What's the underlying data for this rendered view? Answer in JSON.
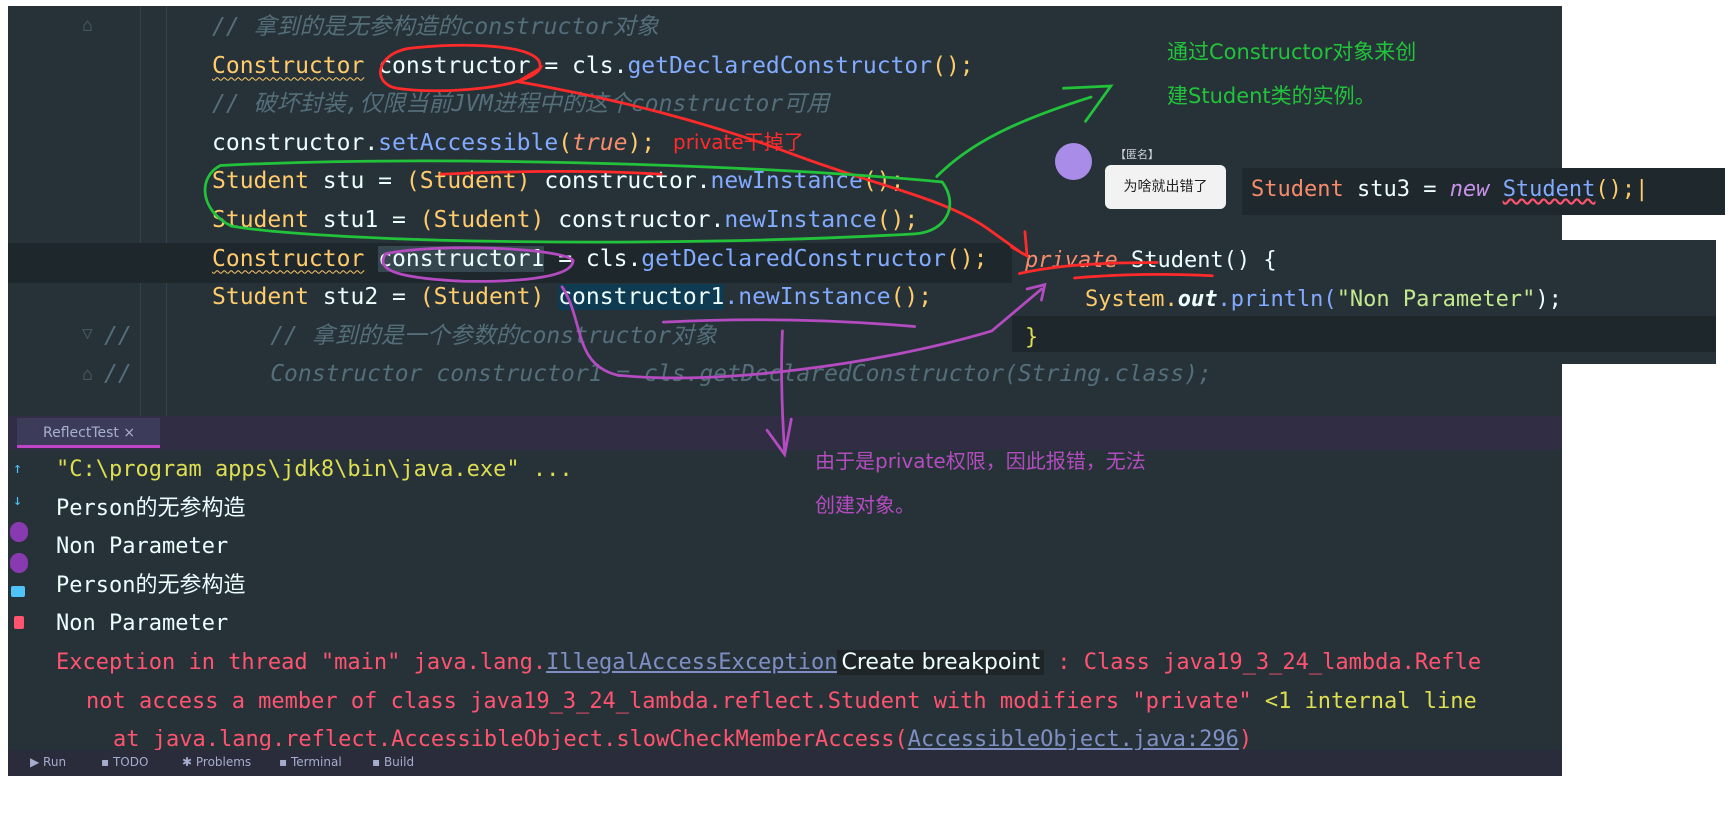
{
  "editor": {
    "lines": [
      {
        "comment": "// 拿到的是无参构造的constructor对象"
      },
      {
        "type": "Constructor",
        "var": "constructor",
        "rest_a": " = cls.",
        "method": "getDeclaredConstructor",
        "rest_b": "();"
      },
      {
        "comment": "// 破坏封装,仅限当前JVM进程中的这个constructor可用"
      },
      {
        "obj": "constructor.",
        "method": "setAccessible",
        "lit": "true",
        "tail": ");"
      },
      {
        "type": "Student",
        "var": " stu = ",
        "cast": "(Student)",
        "obj": " constructor.",
        "method": "newInstance",
        "tail": "();"
      },
      {
        "type": "Student",
        "var": " stu1 = ",
        "cast": "(Student)",
        "obj": " constructor.",
        "method": "newInstance",
        "tail": "();"
      },
      {
        "type": "Constructor",
        "var": "constructor1",
        "rest_a": " = cls.",
        "method": "getDeclaredConstructor",
        "rest_b": "();"
      },
      {
        "type": "Student",
        "var": " stu2 = ",
        "cast": "(Student)",
        "obj": "constructor1",
        "method": "newInstance",
        "tail": "();"
      },
      {
        "prefix": "//",
        "comment": "// 拿到的是一个参数的constructor对象"
      },
      {
        "prefix": "//",
        "comment": "Constructor constructor1 = cls.getDeclaredConstructor(String.class);"
      }
    ]
  },
  "overlay_stu3": {
    "type": "Student",
    "var": " stu3 = ",
    "kw": "new",
    "cls": "Student",
    "tail": "();"
  },
  "overlay_private": {
    "kw": "private",
    "sig": " Student() {",
    "body_obj": "System.",
    "body_out": "out",
    "body_call": ".println(",
    "body_str": "\"Non Parameter\"",
    "body_tail": ");",
    "close": "}"
  },
  "chat": {
    "name": "【匿名】",
    "message": "为啥就出错了"
  },
  "annotations": {
    "red": "private干掉了",
    "green": [
      "通过Constructor对象来创",
      "建Student类的实例。"
    ],
    "purple": [
      "由于是private权限，因此报错，无法",
      "创建对象。"
    ]
  },
  "run_panel": {
    "tab": "ReflectTest",
    "tab_close": "×",
    "console": [
      "\"C:\\program apps\\jdk8\\bin\\java.exe\" ...",
      "Person的无参构造",
      "Non Parameter",
      "Person的无参构造",
      "Non Parameter"
    ],
    "exception": {
      "prefix": "Exception in thread \"main\" java.lang.",
      "link": "IllegalAccessException",
      "tooltip": "Create breakpoint",
      "suffix": " : Class java19_3_24_lambda.Refle"
    },
    "line2": {
      "text": "not access a member of class java19_3_24_lambda.reflect.Student with modifiers \"private\" ",
      "tail": "<1 internal line"
    },
    "line3": {
      "text": "at java.lang.reflect.AccessibleObject.slowCheckMemberAccess(",
      "link": "AccessibleObject.java:296",
      "tail": ")"
    }
  },
  "bottom_bar": [
    "Run",
    "TODO",
    "Problems",
    "Terminal",
    "Build"
  ],
  "colors": {
    "editor_bg": "#263238",
    "red_ink": "#ff2a2a",
    "green_ink": "#22c33a",
    "purple_ink": "#b44bc0"
  }
}
